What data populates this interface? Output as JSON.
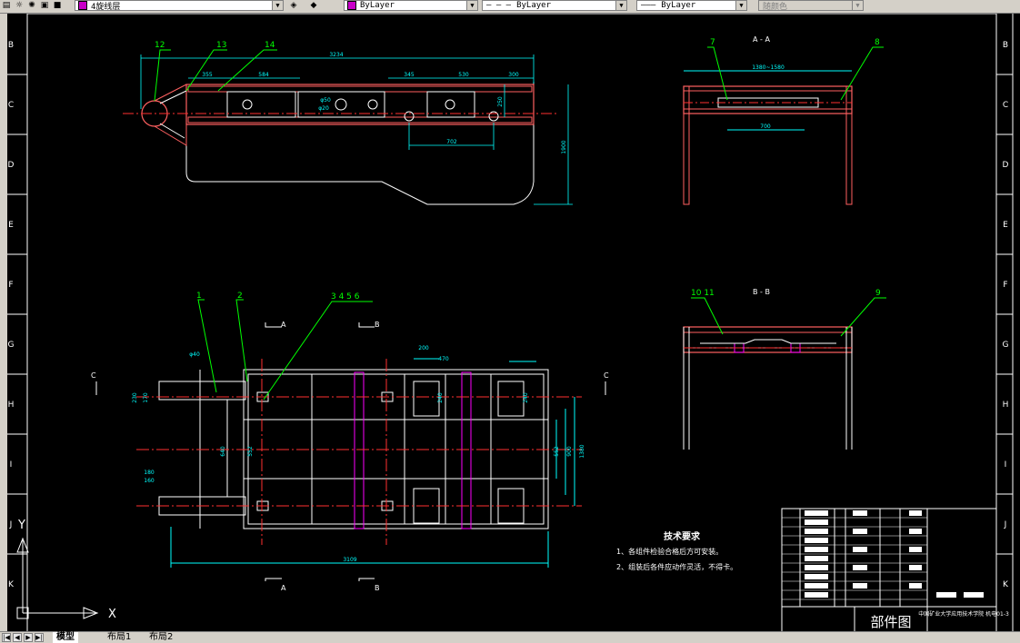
{
  "toolbar": {
    "layer_name": "4旋线层",
    "color_value": "ByLayer",
    "linetype_value": "ByLayer",
    "lineweight_value": "ByLayer",
    "plotstyle_value": "随颜色",
    "layer_color": "#c800c8"
  },
  "tabs": [
    {
      "label": "模型"
    },
    {
      "label": "布局1"
    },
    {
      "label": "布局2"
    }
  ],
  "border": {
    "rows_left": [
      "B",
      "C",
      "D",
      "E",
      "F",
      "G",
      "H",
      "I",
      "J",
      "K"
    ],
    "rows_right": [
      "B",
      "C",
      "D",
      "E",
      "F",
      "G",
      "H",
      "I",
      "J",
      "K"
    ]
  },
  "drawing": {
    "top_view": {
      "callouts": [
        "12",
        "13",
        "14"
      ],
      "dims": [
        "3234",
        "355",
        "584",
        "345",
        "530",
        "300",
        "702",
        "1900",
        "250",
        "φ50",
        "φ20"
      ]
    },
    "section_aa": {
      "title": "A - A",
      "callouts": [
        "7",
        "8"
      ],
      "dims": [
        "1380~1580",
        "700"
      ]
    },
    "section_bb": {
      "title": "B - B",
      "callouts": [
        "10 11",
        "9"
      ]
    },
    "plan_view": {
      "callouts": [
        "1",
        "2",
        "3 4 5 6"
      ],
      "section_marks": [
        "A",
        "B",
        "C"
      ],
      "dims": [
        "3109",
        "1380",
        "900",
        "552",
        "640",
        "552",
        "200",
        "470",
        "φ40",
        "230",
        "170",
        "180",
        "160",
        "240",
        "240"
      ]
    },
    "notes": {
      "title": "技术要求",
      "items": [
        "1、各组件检验合格后方可安装。",
        "2、组装后各件应动作灵活，不得卡。"
      ]
    },
    "title_block": {
      "company": "中国矿业大学应用技术学院 机电01-3",
      "drawing_name": "部件图"
    }
  },
  "ucs": {
    "x_label": "X",
    "y_label": "Y"
  },
  "colors": {
    "frame": "#ffffff",
    "part": "#ff6060",
    "dimension": "#00ffff",
    "centerline": "#ff3030",
    "hatch": "#ff00ff",
    "callout": "#00ff00"
  }
}
